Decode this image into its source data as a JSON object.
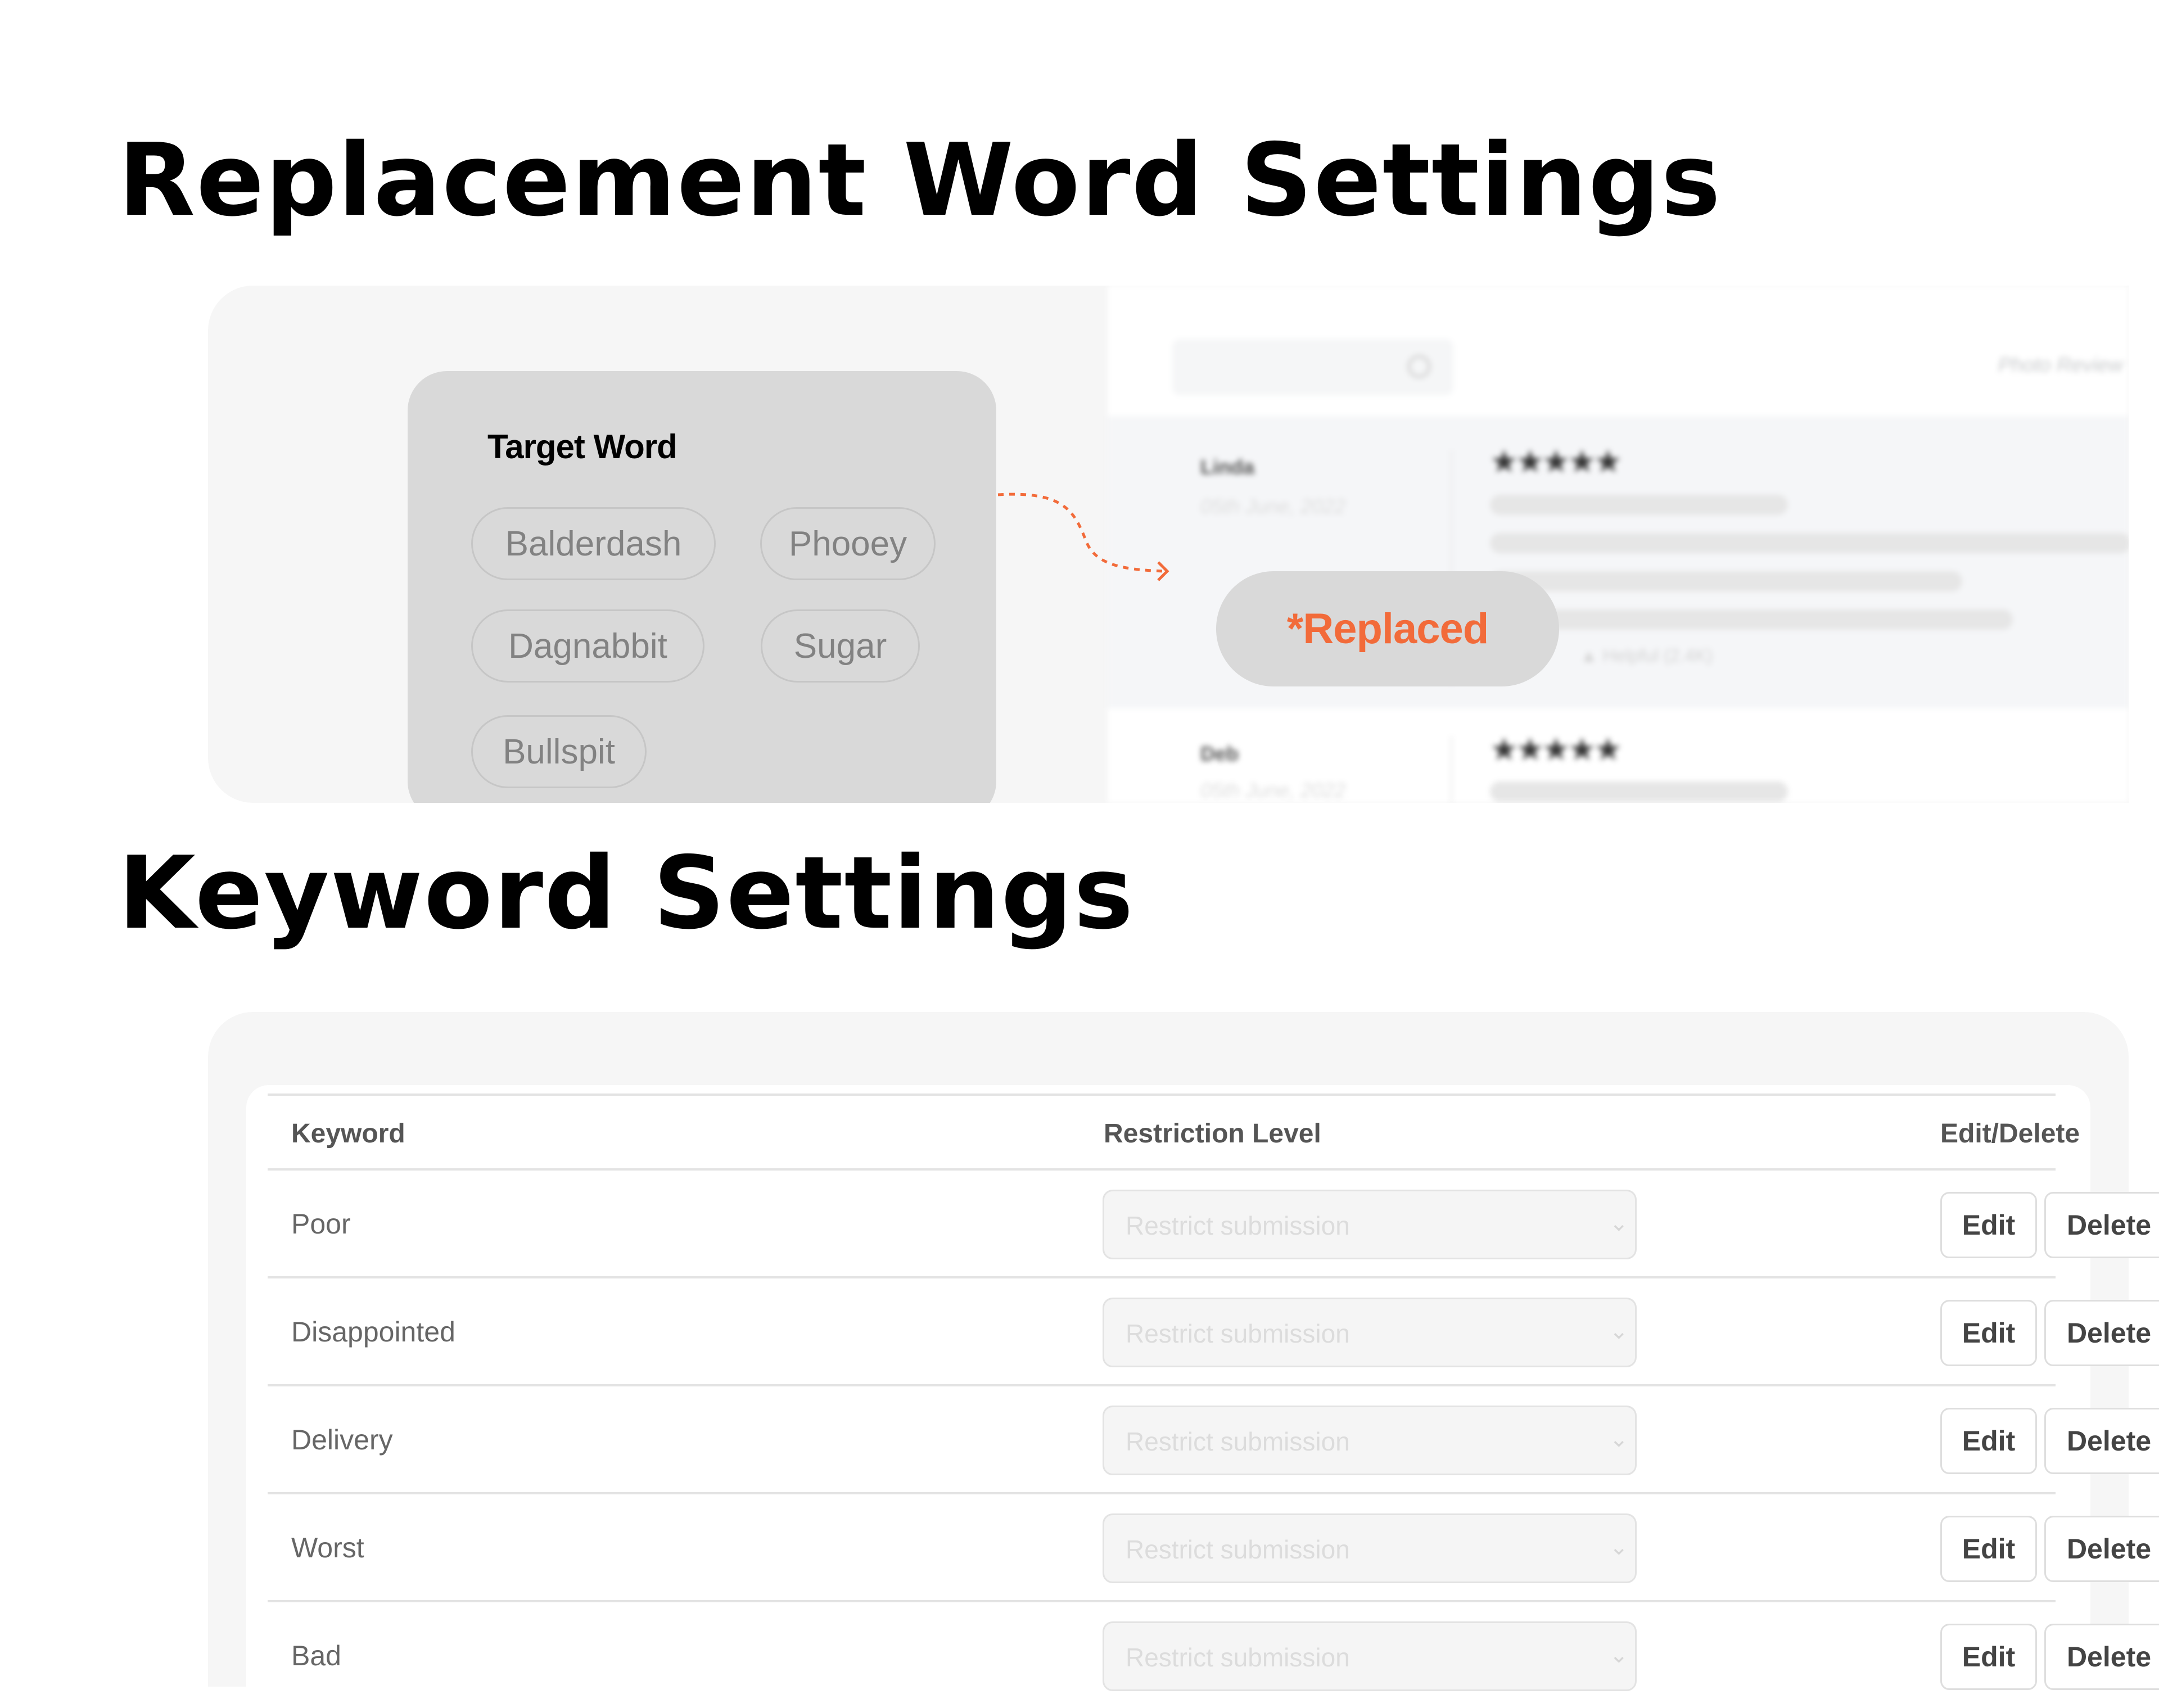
{
  "sections": {
    "replacement_title": "Replacement Word Settings",
    "keyword_title": "Keyword Settings"
  },
  "replacement": {
    "target_title": "Target Word",
    "target_words": [
      "Balderdash",
      "Phooey",
      "Dagnabbit",
      "Sugar",
      "Bullspit"
    ],
    "replaced_label": "*Replaced",
    "accent_color": "#f26b3a"
  },
  "review_preview": {
    "search_icon": "search-icon",
    "photo_review_label": "Photo Review",
    "reviews": [
      {
        "name": "Linda",
        "date": "05th June, 2022",
        "stars": "★★★★★",
        "rating": 5,
        "helpful": "Helpful (2.4K)"
      },
      {
        "name": "Deb",
        "date": "05th June, 2022",
        "stars": "★★★★★",
        "rating": 5
      }
    ]
  },
  "keywords": {
    "headers": {
      "keyword": "Keyword",
      "restriction": "Restriction Level",
      "actions": "Edit/Delete"
    },
    "rows": [
      {
        "keyword": "Poor",
        "restriction": "Restrict submission"
      },
      {
        "keyword": "Disappointed",
        "restriction": "Restrict submission"
      },
      {
        "keyword": "Delivery",
        "restriction": "Restrict submission"
      },
      {
        "keyword": "Worst",
        "restriction": "Restrict submission"
      },
      {
        "keyword": "Bad",
        "restriction": "Restrict submission"
      }
    ],
    "edit_label": "Edit",
    "delete_label": "Delete",
    "chevron": "⌄"
  }
}
